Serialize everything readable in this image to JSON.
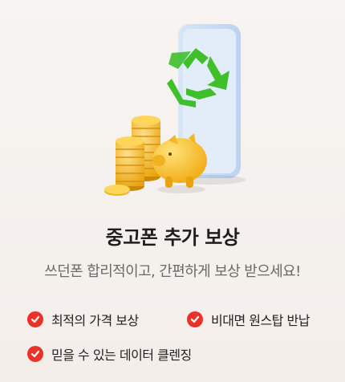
{
  "title": "중고폰 추가 보상",
  "subtitle": "쓰던폰 합리적이고, 간편하게 보상 받으세요!",
  "benefits": [
    {
      "label": "최적의 가격 보상",
      "icon": "check-circle-icon"
    },
    {
      "label": "비대면 원스탑 반납",
      "icon": "check-circle-icon"
    },
    {
      "label": "믿을 수 있는 데이터 클렌징",
      "icon": "check-circle-icon"
    }
  ],
  "colors": {
    "accent": "#e8322a",
    "recycle": "#3fbf2a",
    "coin": "#f2b51c",
    "phone": "#cfe0f6"
  },
  "illustration": {
    "icons": [
      "phone-icon",
      "recycle-icon",
      "coin-stack-icon",
      "piggy-bank-icon"
    ]
  }
}
